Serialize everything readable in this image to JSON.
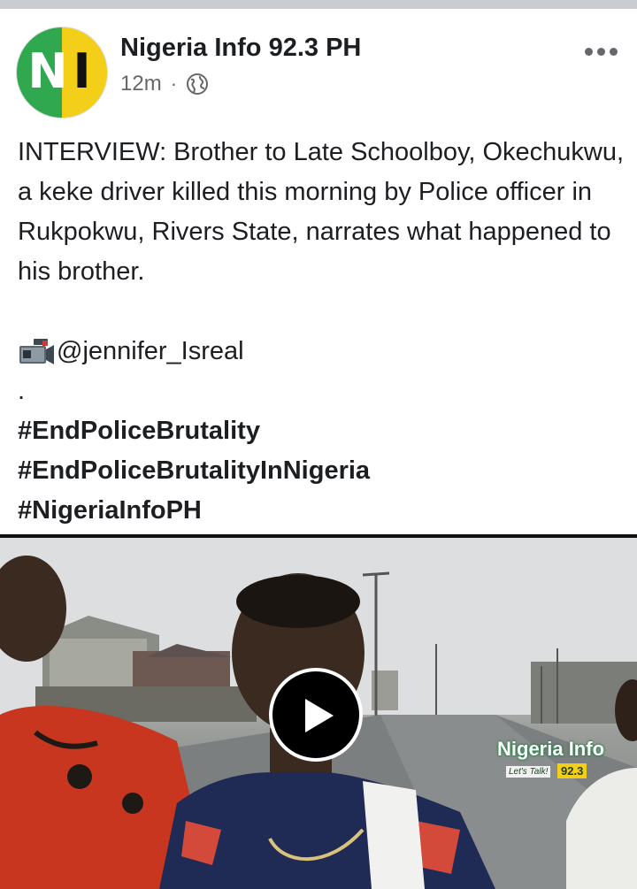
{
  "post": {
    "page_name": "Nigeria Info 92.3 PH",
    "time_ago": "12m",
    "separator": "·",
    "avatar_letters": [
      "N",
      "I"
    ],
    "privacy_icon": "globe-icon",
    "menu_icon": "more-options-icon",
    "text": {
      "paragraph": "INTERVIEW: Brother to Late Schoolboy, Okechukwu, a keke driver killed this morning by Police officer in Rukpokwu, Rivers State, narrates what happened to his brother.",
      "camera_icon": "video-camera-icon",
      "credit": "@jennifer_Isreal",
      "dot_line": ".",
      "hashtags": [
        "#EndPoliceBrutality",
        "#EndPoliceBrutalityInNigeria",
        "#NigeriaInfoPH"
      ]
    },
    "video": {
      "play_icon": "play-icon",
      "watermark_title": "Nigeria Info",
      "watermark_tagline": "Let's Talk!",
      "watermark_frequency": "92.3"
    }
  },
  "colors": {
    "brand_green": "#2fa84f",
    "brand_yellow": "#f3cf1a",
    "secondary_text": "#65676b",
    "primary_text": "#1c1e21"
  }
}
